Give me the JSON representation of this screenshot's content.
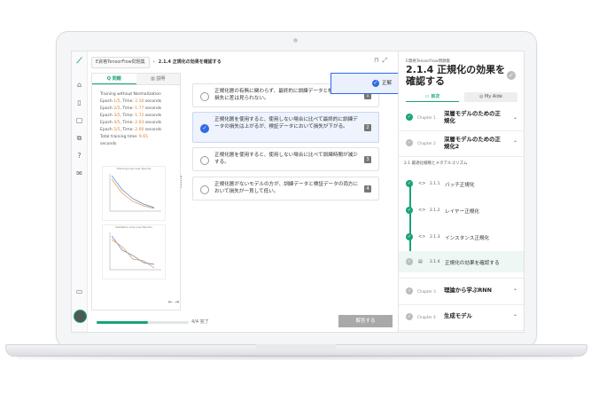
{
  "app": {
    "book_label": "E資格TensorFlow問題集",
    "page_title": "2.1.4 正規化の効果を確認する"
  },
  "left_panel": {
    "tabs": [
      {
        "label": "Q 問題",
        "active": true
      },
      {
        "label": "▥ 説明",
        "active": false
      }
    ],
    "log_title": "Training without Normalization",
    "epochs": [
      {
        "label": "Epoch",
        "frac": "1/5",
        "rest": ", Time: ",
        "time": "2.10",
        "unit": " seconds"
      },
      {
        "label": "Epoch",
        "frac": "2/5",
        "rest": ", Time: ",
        "time": "1.77",
        "unit": " seconds"
      },
      {
        "label": "Epoch",
        "frac": "3/5",
        "rest": ", Time: ",
        "time": "1.72",
        "unit": " seconds"
      },
      {
        "label": "Epoch",
        "frac": "4/5",
        "rest": ", Time: ",
        "time": "2.03",
        "unit": " seconds"
      },
      {
        "label": "Epoch",
        "frac": "5/5",
        "rest": ", Time: ",
        "time": "2.00",
        "unit": " seconds"
      }
    ],
    "total_label": "Total training time: ",
    "total_value": "9.65",
    "total_unit": "seconds",
    "plot1_title": "Training Loss over Epochs",
    "plot2_title": "Validation Loss over Epochs"
  },
  "options": [
    {
      "text": "正規化層の有無に関わらず、最終的に訓練データと検証データの損失に差は見られない。",
      "num": "1",
      "selected": false
    },
    {
      "text": "正規化層を使用すると、使用しない場合に比べて最終的に訓練データの損失は上がるが、検証データにおいて損失が下がる。",
      "num": "2",
      "selected": true
    },
    {
      "text": "正規化層を使用すると、使用しない場合に比べて訓練時間が減少する。",
      "num": "3",
      "selected": false
    },
    {
      "text": "正規化層がないモデルの方が、訓練データと検証データの両方において損失が一貫して低い。",
      "num": "4",
      "selected": false
    }
  ],
  "toast": {
    "label": "正解"
  },
  "footer": {
    "progress_fraction": 0.56,
    "progress_label": "4/4 完了",
    "submit_label": "解答する"
  },
  "toc": {
    "subtitle": "E資格TensorFlow問題集",
    "title": "2.1.4 正規化の効果を確認する",
    "tabs": [
      {
        "label": "▭ 目次",
        "active": true
      },
      {
        "label": "◎ My Aide",
        "active": false
      }
    ],
    "chapters": [
      {
        "label": "Chapter 1",
        "title": "深層モデルのための正規化",
        "done": true,
        "chevron": "⌄"
      },
      {
        "label": "Chapter 2",
        "title": "深層モデルのための正規化2",
        "done": false,
        "chevron": "⌃"
      },
      {
        "label": "Chapter 3",
        "title": "理論から学ぶRNN",
        "done": false,
        "chevron": "⌃"
      },
      {
        "label": "Chapter 4",
        "title": "生成モデル",
        "done": false,
        "chevron": "⌃"
      }
    ],
    "section": "2.1  最適化戦略とメタアルゴリズム",
    "lessons": [
      {
        "code": "<>",
        "num": "2.1.1",
        "title": "バッチ正規化",
        "done": true
      },
      {
        "code": "<>",
        "num": "2.1.2",
        "title": "レイヤー正規化",
        "done": true
      },
      {
        "code": "<>",
        "num": "2.1.3",
        "title": "インスタンス正規化",
        "done": true
      },
      {
        "code": "▤",
        "num": "2.1.4",
        "title": "正規化の効果を確認する",
        "done": false
      }
    ]
  }
}
